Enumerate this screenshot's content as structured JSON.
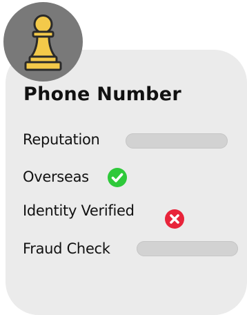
{
  "card": {
    "title": "Phone Number",
    "avatar_icon": "chess-pawn-icon",
    "rows": [
      {
        "label": "Reputation",
        "status": "loading-placeholder"
      },
      {
        "label": "Overseas",
        "status": "check-icon",
        "status_color": "#2ec93a"
      },
      {
        "label": "Identity Verified",
        "status": "cross-icon",
        "status_color": "#e8243a"
      },
      {
        "label": "Fraud Check",
        "status": "loading-placeholder"
      }
    ]
  },
  "colors": {
    "card_bg": "#ebebeb",
    "avatar_bg": "#797979",
    "pawn_fill": "#f3c94a",
    "pawn_outline": "#2a2a2a",
    "placeholder": "#d2d2d2"
  }
}
